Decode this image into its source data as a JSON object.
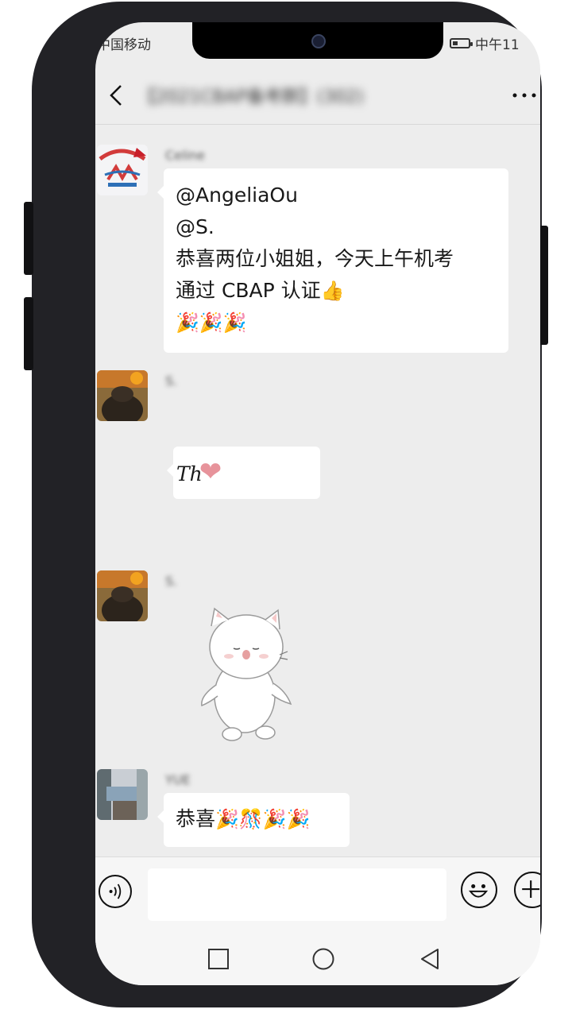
{
  "status_bar": {
    "carrier": "中国移动",
    "time": "中午11"
  },
  "header": {
    "chat_title": "【2021CBAP备考群】(302)"
  },
  "messages": [
    {
      "sender": "Celine",
      "lines": [
        "@AngeliaOu",
        "@S.",
        "恭喜两位小姐姐，今天上午机考",
        "通过 CBAP 认证"
      ],
      "thumb_emoji": "👍",
      "emoji_line": "🎉🎉🎉"
    },
    {
      "sender": "S.",
      "text": "Th",
      "heart_emoji": "❤"
    },
    {
      "sender": "S.",
      "sticker": "white-cat-sticker"
    },
    {
      "sender": "YUE",
      "text": "恭喜",
      "emoji_tail": "🎉🎊🎉🎉"
    }
  ],
  "input": {
    "value": "",
    "placeholder": ""
  },
  "colors": {
    "screen_bg": "#ededed",
    "bubble": "#ffffff",
    "frame": "#222226"
  }
}
